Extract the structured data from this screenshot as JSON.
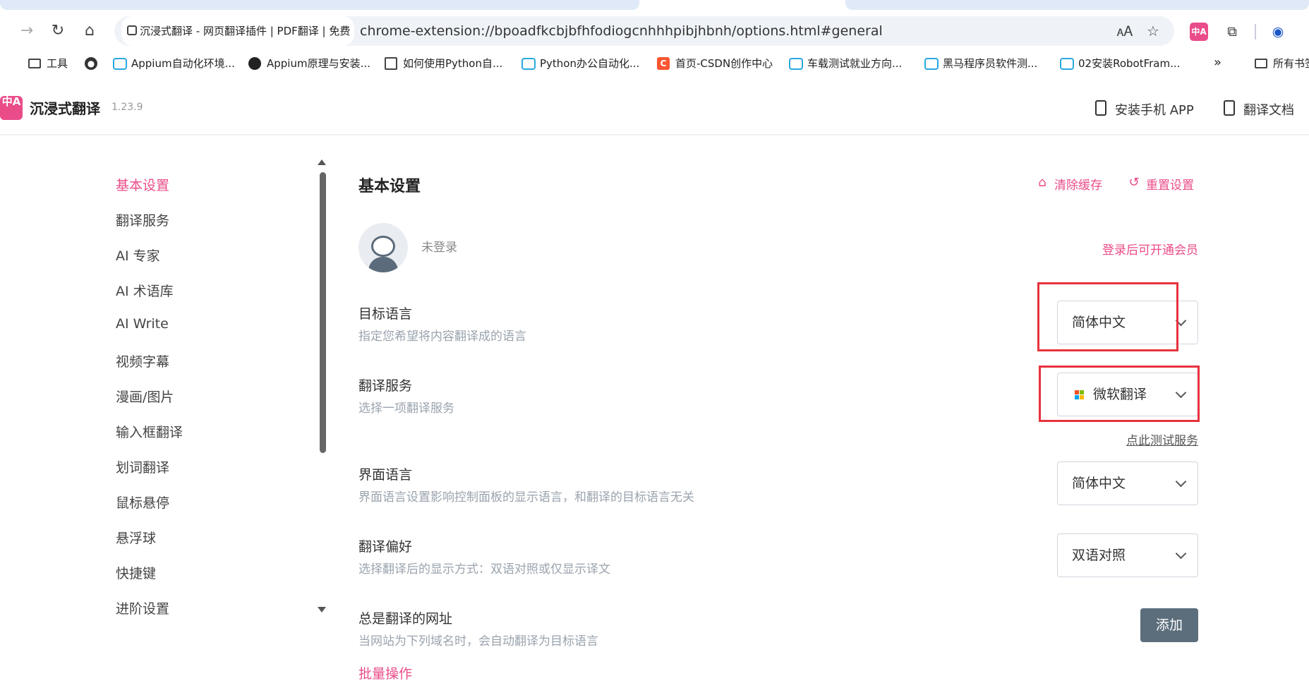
{
  "browser": {
    "tab_title": "沉浸式翻译 - 网页翻译插件 | PDF翻译 | 免费",
    "url": "chrome-extension://bpoadfkcbjbfhfodiogcnhhhpibjhbnh/options.html#general",
    "bookmarks": [
      {
        "label": "工具",
        "icon": "folder-icon"
      },
      {
        "label": "",
        "icon": "globe-icon"
      },
      {
        "label": "Appium自动化环境...",
        "icon": "bilibili-icon"
      },
      {
        "label": "Appium原理与安装...",
        "icon": "site-icon"
      },
      {
        "label": "如何使用Python自...",
        "icon": "page-icon"
      },
      {
        "label": "Python办公自动化...",
        "icon": "bilibili-icon"
      },
      {
        "label": "首页-CSDN创作中心",
        "icon": "csdn-icon"
      },
      {
        "label": "车载测试就业方向...",
        "icon": "bilibili-icon"
      },
      {
        "label": "黑马程序员软件测...",
        "icon": "bilibili-icon"
      },
      {
        "label": "02安装RobotFram...",
        "icon": "bilibili-icon"
      }
    ],
    "bookmarks_more": "»",
    "bookmarks_all": "所有书签"
  },
  "header": {
    "app_name": "沉浸式翻译",
    "version": "1.23.9",
    "logo_text": "中A",
    "install_app": "安装手机 APP",
    "docs": "翻译文档"
  },
  "sidebar": {
    "items": [
      {
        "label": "基本设置",
        "active": true
      },
      {
        "label": "翻译服务"
      },
      {
        "label": "AI 专家"
      },
      {
        "label": "AI 术语库"
      },
      {
        "label": "AI Write"
      },
      {
        "label": "视频字幕"
      },
      {
        "label": "漫画/图片"
      },
      {
        "label": "输入框翻译"
      },
      {
        "label": "划词翻译"
      },
      {
        "label": "鼠标悬停"
      },
      {
        "label": "悬浮球"
      },
      {
        "label": "快捷键"
      },
      {
        "label": "进阶设置"
      }
    ]
  },
  "main": {
    "title": "基本设置",
    "clear_cache": "清除缓存",
    "reset": "重置设置",
    "login_status": "未登录",
    "member_link": "登录后可开通会员",
    "target_language": {
      "label": "目标语言",
      "desc": "指定您希望将内容翻译成的语言",
      "value": "简体中文"
    },
    "translate_service": {
      "label": "翻译服务",
      "desc": "选择一项翻译服务",
      "value": "微软翻译",
      "test_link": "点此测试服务"
    },
    "ui_language": {
      "label": "界面语言",
      "desc": "界面语言设置影响控制面板的显示语言，和翻译的目标语言无关",
      "value": "简体中文"
    },
    "translate_pref": {
      "label": "翻译偏好",
      "desc": "选择翻译后的显示方式：双语对照或仅显示译文",
      "value": "双语对照"
    },
    "always_translate": {
      "label": "总是翻译的网址",
      "desc": "当网站为下列域名时，会自动翻译为目标语言",
      "add_button": "添加"
    },
    "batch": "批量操作"
  },
  "colors": {
    "accent": "#ea4c89",
    "highlight_box": "#e8323c",
    "button_bg": "#5c6e7c"
  }
}
